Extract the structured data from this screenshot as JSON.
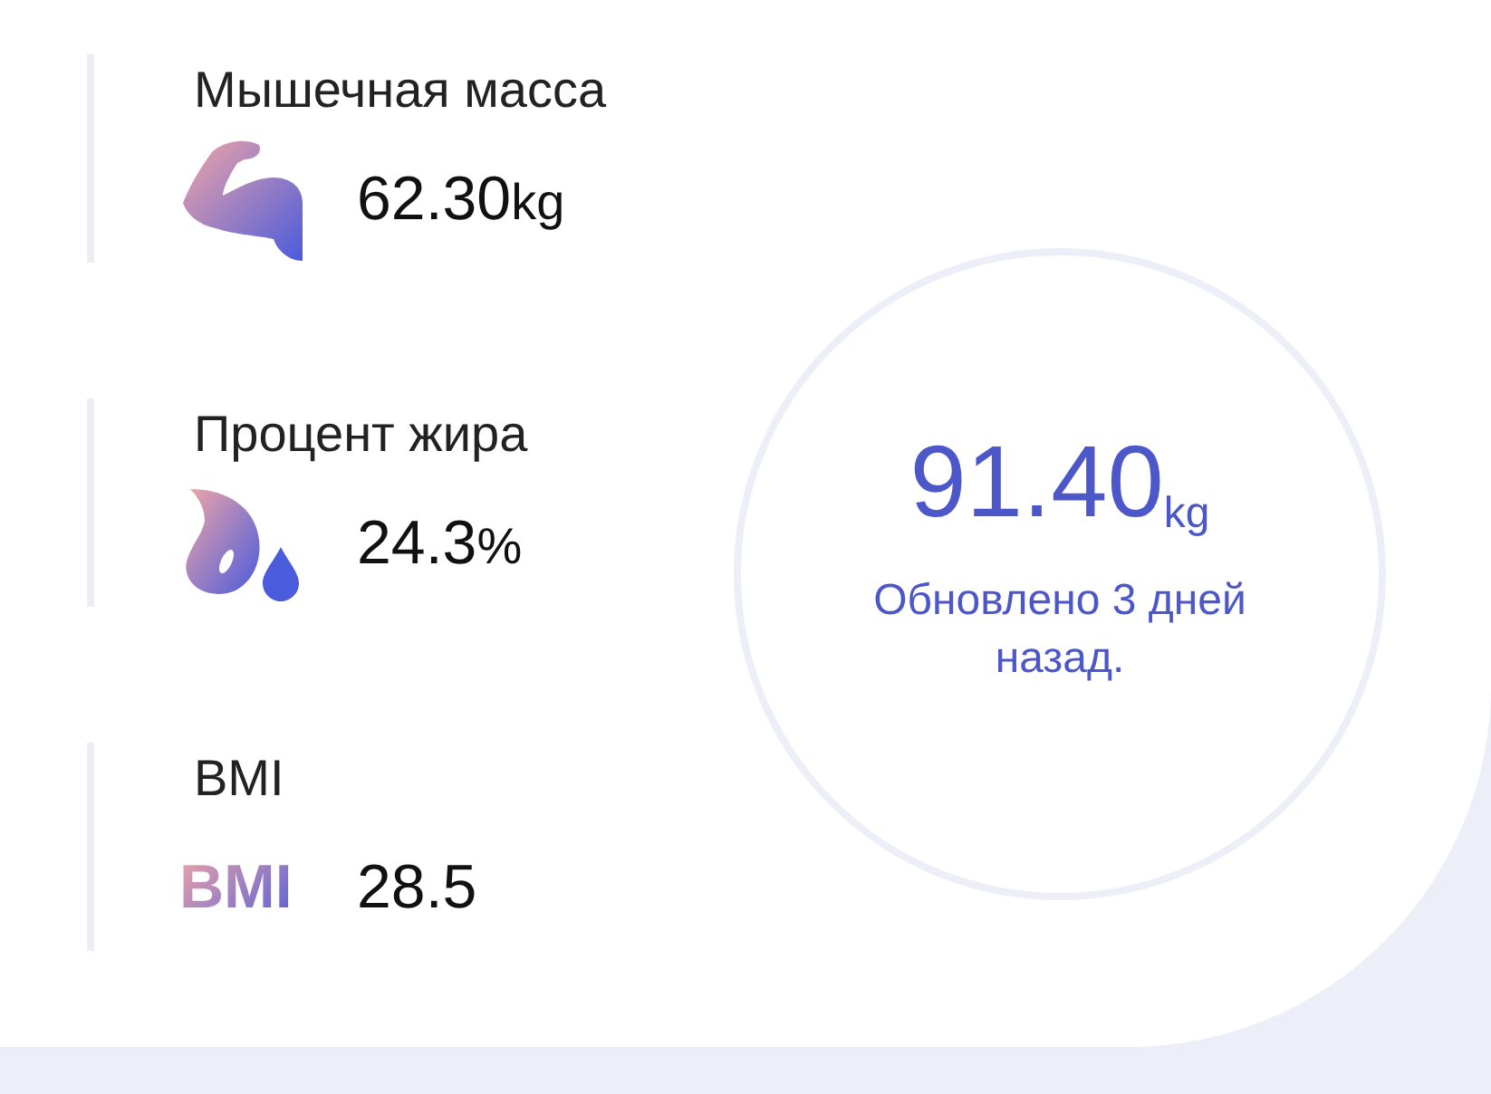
{
  "metrics": [
    {
      "kind": "muscle",
      "label": "Мышечная масса",
      "value": "62.30",
      "unit": "kg"
    },
    {
      "kind": "fat",
      "label": "Процент жира",
      "value": "24.3",
      "unit": "%"
    },
    {
      "kind": "bmi",
      "label": "BMI",
      "badge": "BMI",
      "value": "28.5"
    }
  ],
  "weight": {
    "value": "91.40$_{kg}$",
    "updated": "Обновлено 3 дней назад."
  }
}
